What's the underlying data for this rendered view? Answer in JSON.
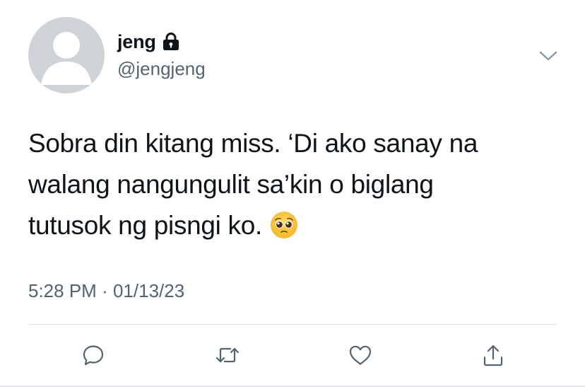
{
  "author": {
    "display_name": "jeng",
    "handle": "@jengjeng",
    "protected_icon": "lock-icon",
    "avatar": "default-avatar"
  },
  "tweet": {
    "text_lines": [
      "Sobra din kitang miss. ‘Di ako sanay na",
      "walang nangungulit sa’kin o biglang",
      "tutusok ng pisngi ko."
    ],
    "emoji": "pleading-face-emoji",
    "time": "5:28 PM",
    "separator": "·",
    "date": "01/13/23"
  },
  "actions": [
    {
      "name": "reply",
      "icon": "reply-icon"
    },
    {
      "name": "retweet",
      "icon": "retweet-icon"
    },
    {
      "name": "like",
      "icon": "heart-icon"
    },
    {
      "name": "share",
      "icon": "share-icon"
    }
  ],
  "colors": {
    "text_primary": "#0f1419",
    "text_secondary": "#536471",
    "avatar_bg": "#cfd3d7",
    "divider": "#dbe1e5"
  }
}
